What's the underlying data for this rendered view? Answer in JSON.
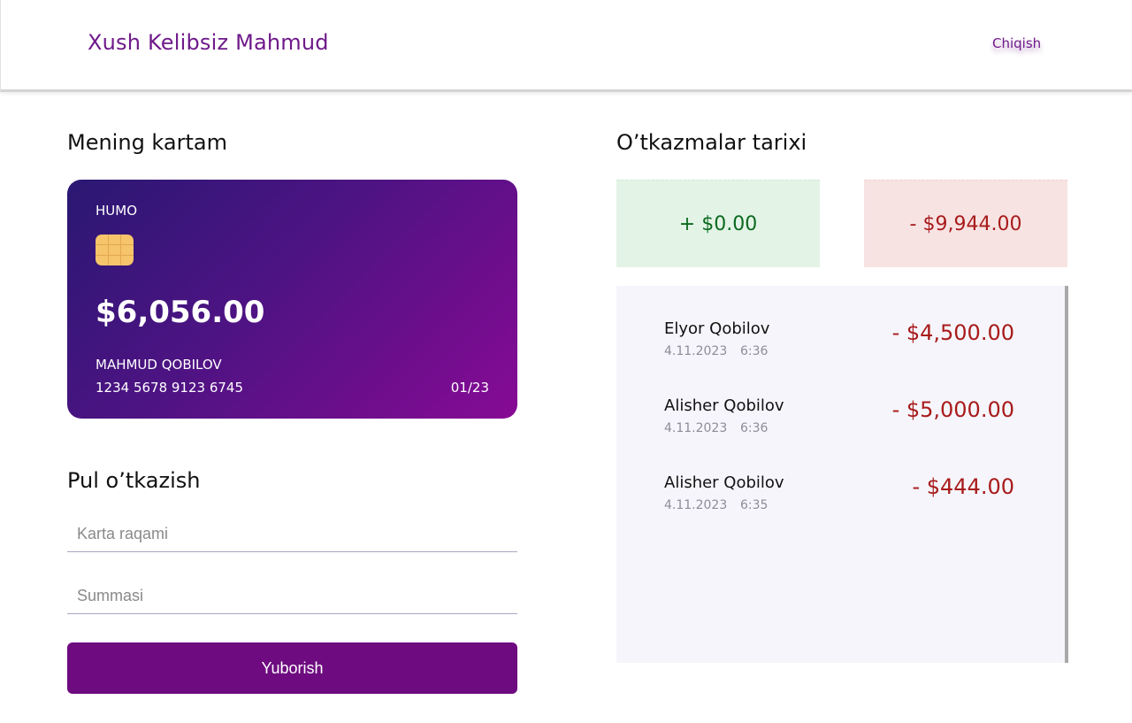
{
  "header": {
    "welcome": "Xush Kelibsiz Mahmud",
    "logout_label": "Chiqish"
  },
  "card_section": {
    "title": "Mening kartam",
    "card": {
      "brand": "HUMO",
      "balance": "$6,056.00",
      "holder": "MAHMUD QOBILOV",
      "number": "1234 5678 9123 6745",
      "expiry": "01/23"
    }
  },
  "transfer": {
    "title": "Pul o’tkazish",
    "card_placeholder": "Karta raqami",
    "amount_placeholder": "Summasi",
    "submit_label": "Yuborish"
  },
  "history": {
    "title": "O’tkazmalar tarixi",
    "income_total": "+ $0.00",
    "outgoing_total": "- $9,944.00",
    "transactions": [
      {
        "name": "Elyor Qobilov",
        "date": "4.11.2023",
        "time": "6:36",
        "amount": "- $4,500.00"
      },
      {
        "name": "Alisher Qobilov",
        "date": "4.11.2023",
        "time": "6:36",
        "amount": "- $5,000.00"
      },
      {
        "name": "Alisher Qobilov",
        "date": "4.11.2023",
        "time": "6:35",
        "amount": "- $444.00"
      }
    ]
  },
  "colors": {
    "accent": "#6e0b80",
    "income": "#0b6a1f",
    "outgoing": "#a81b1b"
  }
}
